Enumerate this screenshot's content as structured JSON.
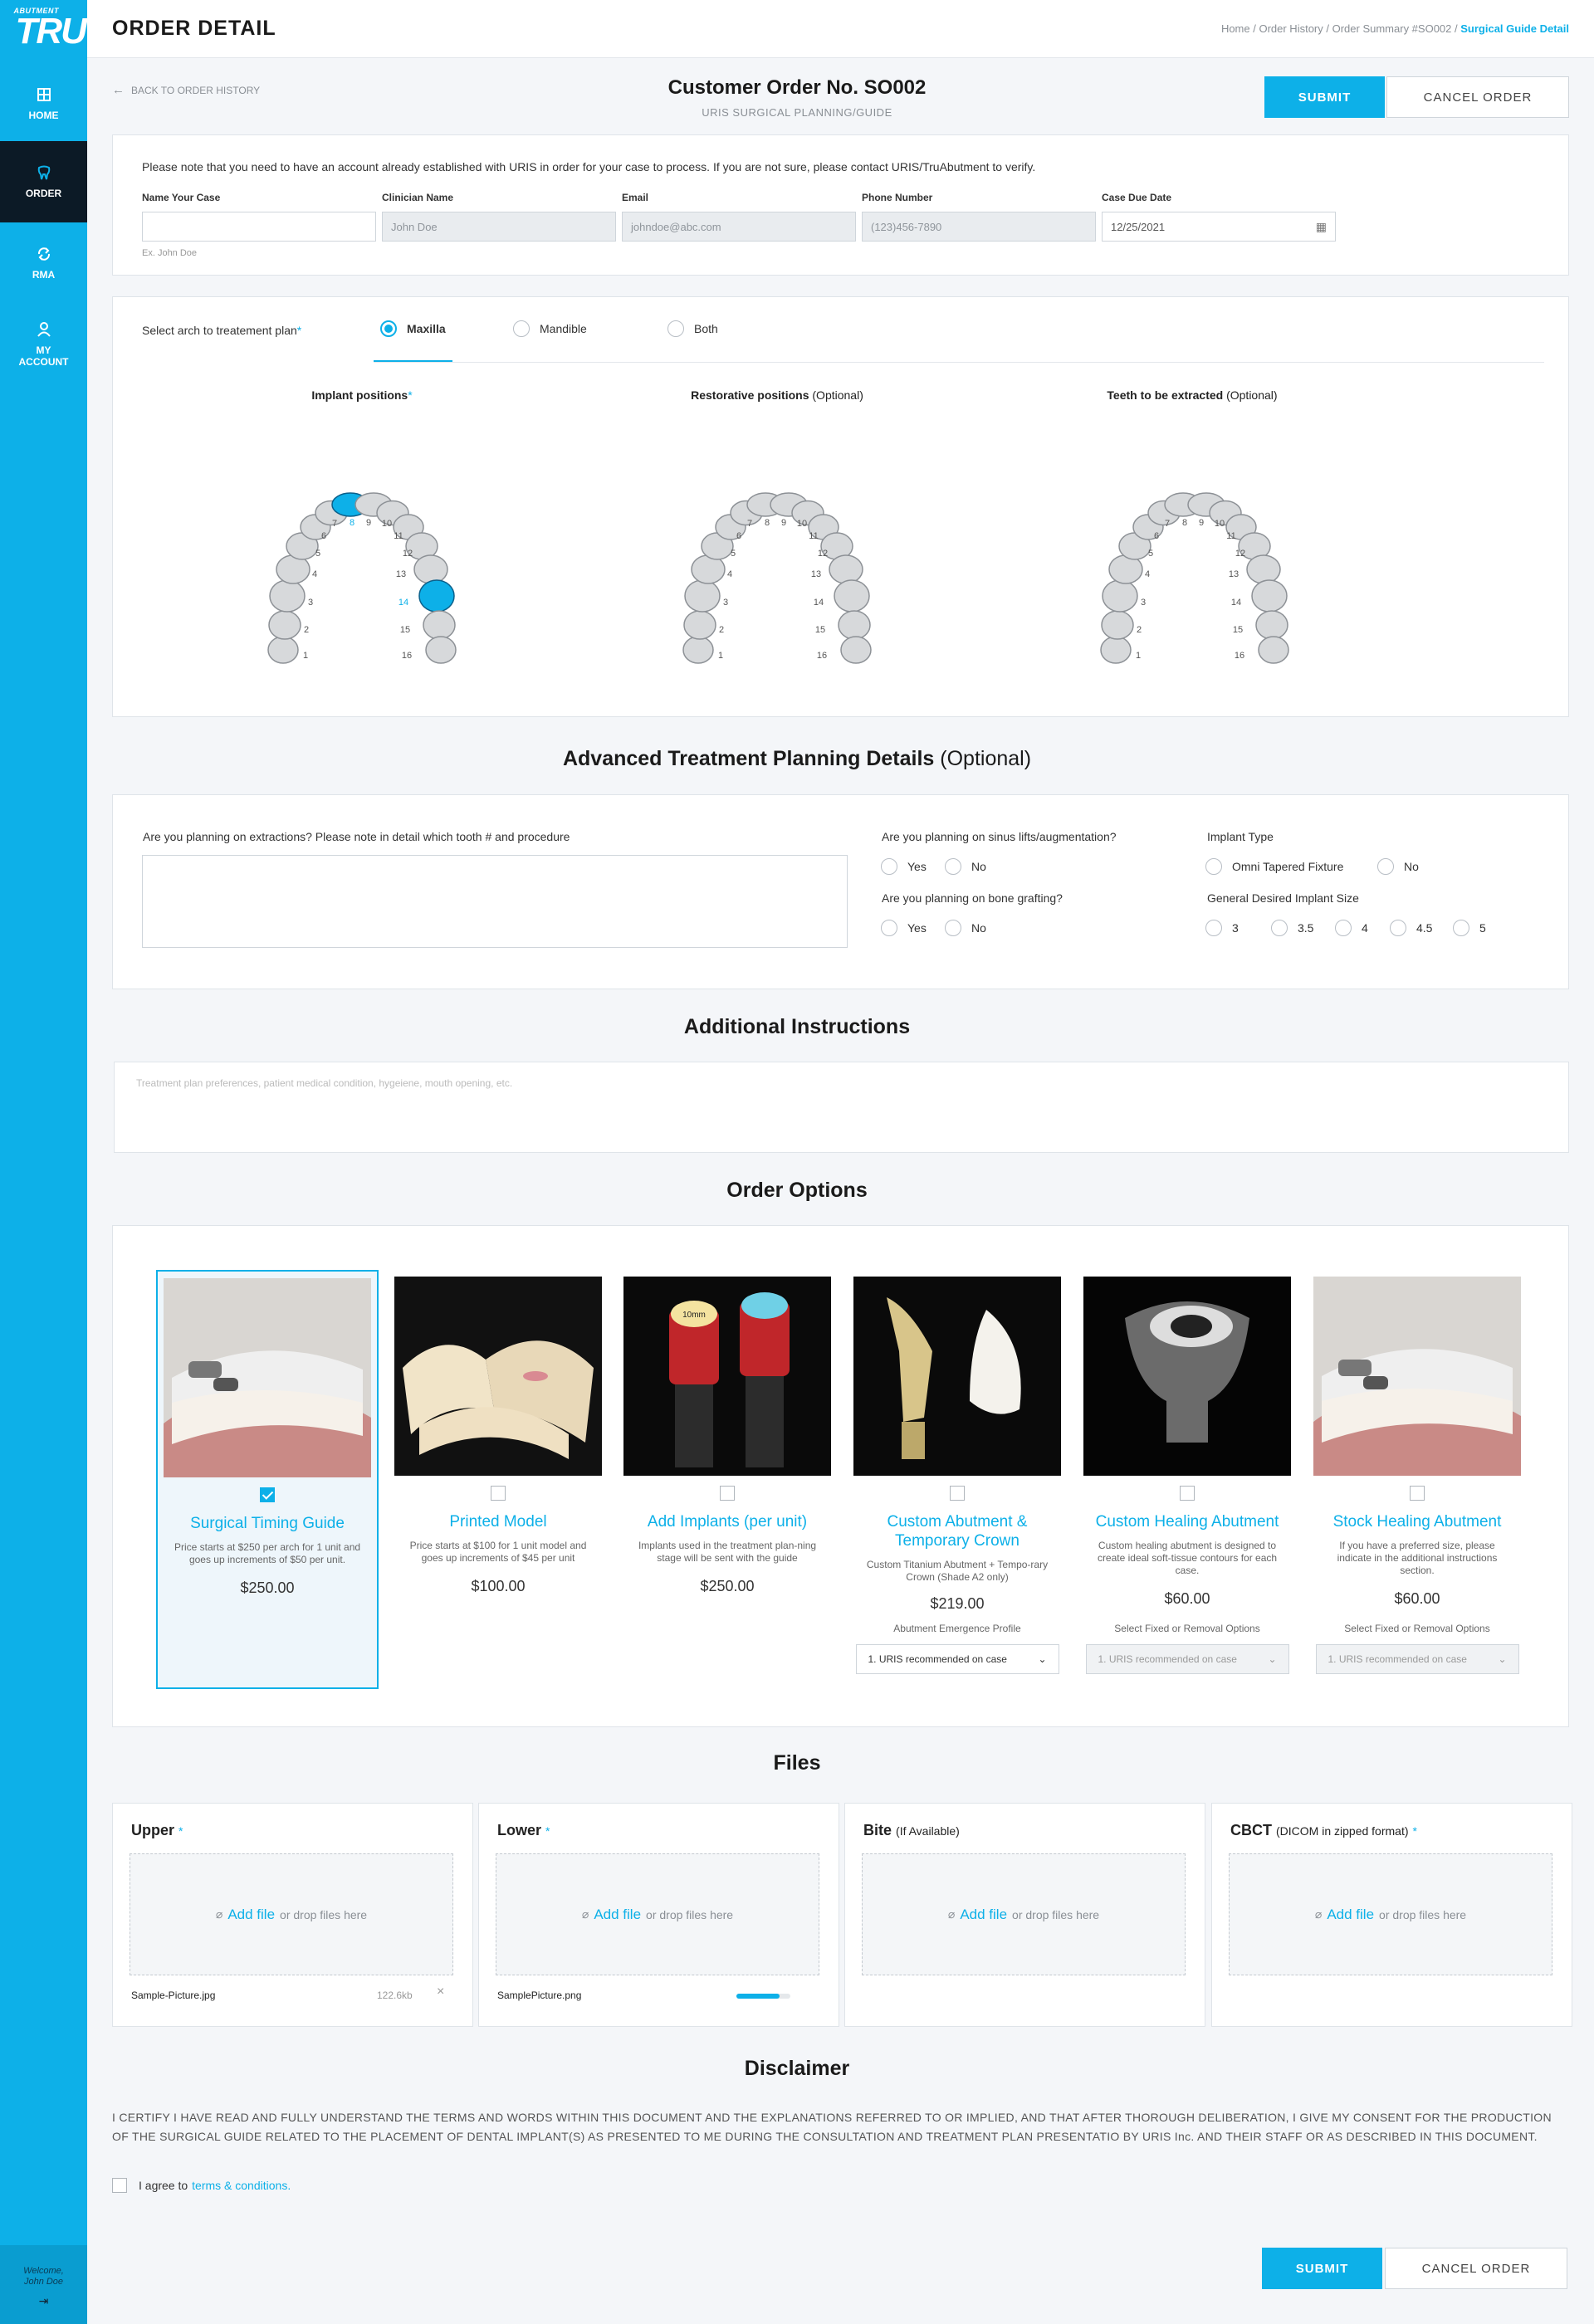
{
  "sidebar": {
    "logo_top": "ABUTMENT",
    "logo_main": "TRU",
    "items": [
      {
        "label": "HOME"
      },
      {
        "label": "ORDER"
      },
      {
        "label": "RMA"
      },
      {
        "label": "MY ACCOUNT"
      }
    ],
    "welcome_line1": "Welcome,",
    "welcome_line2": "John Doe"
  },
  "header": {
    "title": "ORDER DETAIL",
    "breadcrumb": [
      "Home",
      "Order History",
      "Order Summary #SO002",
      "Surgical Guide Detail"
    ]
  },
  "order": {
    "back_label": "BACK TO ORDER HISTORY",
    "title": "Customer Order No. SO002",
    "subtitle": "URIS SURGICAL PLANNING/GUIDE",
    "submit_label": "SUBMIT",
    "cancel_label": "CANCEL ORDER"
  },
  "case_info": {
    "note": "Please note that you need to have an account already established with URIS in order for your case to process. If you are not sure, please contact URIS/TruAbutment to verify.",
    "fields": [
      {
        "label": "Name Your Case",
        "value": "",
        "hint": "Ex. John Doe"
      },
      {
        "label": "Clinician Name",
        "value": "John Doe"
      },
      {
        "label": "Email",
        "value": "johndoe@abc.com"
      },
      {
        "label": "Phone Number",
        "value": "(123)456-7890"
      },
      {
        "label": "Case Due Date",
        "value": "12/25/2021"
      }
    ]
  },
  "arch": {
    "label": "Select arch to treatement plan",
    "options": [
      "Maxilla",
      "Mandible",
      "Both"
    ],
    "selected": "Maxilla",
    "charts": [
      {
        "title_bold": "Implant positions",
        "title_rest": "",
        "required": true
      },
      {
        "title_bold": "Restorative positions",
        "title_rest": " (Optional)",
        "required": false
      },
      {
        "title_bold": "Teeth to be extracted",
        "title_rest": " (Optional)",
        "required": false
      }
    ],
    "tooth_numbers": [
      "1",
      "2",
      "3",
      "4",
      "5",
      "6",
      "7",
      "8",
      "9",
      "10",
      "11",
      "12",
      "13",
      "14",
      "15",
      "16"
    ],
    "selected_implants": [
      "8",
      "14"
    ],
    "highlight_color": "#0db0e8"
  },
  "advanced": {
    "title": "Advanced Treatment Planning Details",
    "title_opt": "(Optional)",
    "extraction_q": "Are you planning on extractions? Please note in detail which tooth # and procedure",
    "sinus_q": "Are you planning on sinus lifts/augmentation?",
    "bone_q": "Are you planning on bone grafting?",
    "yes": "Yes",
    "no": "No",
    "implant_type_q": "Implant Type",
    "implant_type_opts": [
      "Omni Tapered Fixture",
      "No"
    ],
    "size_q": "General Desired Implant Size",
    "sizes": [
      "3",
      "3.5",
      "4",
      "4.5",
      "5"
    ]
  },
  "additional": {
    "title": "Additional Instructions",
    "placeholder": "Treatment plan preferences, patient medical condition, hygeiene, mouth opening, etc."
  },
  "options": {
    "title": "Order Options",
    "items": [
      {
        "name": "Surgical Timing Guide",
        "desc": "Price starts at $250 per arch for 1 unit and goes up increments of $50 per unit.",
        "price": "$250.00",
        "checked": true
      },
      {
        "name": "Printed Model",
        "desc": "Price starts at $100 for 1 unit model and goes up increments of $45 per unit",
        "price": "$100.00",
        "checked": false
      },
      {
        "name": "Add Implants (per unit)",
        "desc": "Implants used in the treatment plan-ning stage will be sent with the guide",
        "price": "$250.00",
        "checked": false
      },
      {
        "name": "Custom Abutment & Temporary Crown",
        "desc": "Custom Titanium Abutment + Tempo-rary Crown (Shade A2 only)",
        "price": "$219.00",
        "checked": false,
        "sub_label": "Abutment Emergence Profile",
        "select_value": "1. URIS recommended on case",
        "select_disabled": false
      },
      {
        "name": "Custom Healing Abutment",
        "desc": "Custom healing abutment is designed to create ideal soft-tissue contours for each case.",
        "price": "$60.00",
        "checked": false,
        "sub_label": "Select Fixed or Removal Options",
        "select_value": "1. URIS recommended on case",
        "select_disabled": true
      },
      {
        "name": "Stock Healing Abutment",
        "desc": "If you have a preferred size, please indicate in the additional instructions section.",
        "price": "$60.00",
        "checked": false,
        "sub_label": "Select Fixed or Removal Options",
        "select_value": "1. URIS recommended on case",
        "select_disabled": true
      }
    ],
    "bottle_label": "10mm"
  },
  "files": {
    "title": "Files",
    "add_label": "Add file",
    "drop_label": "or drop files here",
    "cards": [
      {
        "title": "Upper",
        "paren": "",
        "required": true,
        "file": "Sample-Picture.jpg",
        "size": "122.6kb",
        "progress": null
      },
      {
        "title": "Lower",
        "paren": "",
        "required": true,
        "file": "SamplePicture.png",
        "size": "",
        "progress": 0.8
      },
      {
        "title": "Bite",
        "paren": "(If Available)",
        "required": false,
        "file": "",
        "size": "",
        "progress": null
      },
      {
        "title": "CBCT",
        "paren": "(DICOM in zipped format)",
        "required": true,
        "file": "",
        "size": "",
        "progress": null
      }
    ]
  },
  "disclaimer": {
    "title": "Disclaimer",
    "text": "I CERTIFY I HAVE READ AND FULLY UNDERSTAND THE TERMS AND WORDS WITHIN THIS DOCUMENT AND THE EXPLANATIONS REFERRED TO OR IMPLIED, AND THAT AFTER THOROUGH DELIBERATION, I GIVE MY CONSENT FOR THE PRODUCTION OF THE SURGICAL GUIDE RELATED TO THE PLACEMENT OF DENTAL IMPLANT(S) AS PRESENTED TO ME DURING THE CONSULTATION AND TREATMENT PLAN PRESENTATIO BY URIS Inc. AND THEIR STAFF OR AS DESCRIBED IN THIS DOCUMENT.",
    "agree_label": "I agree to",
    "terms_link": "terms & conditions."
  },
  "colors": {
    "accent": "#0db0e8",
    "sidebar_active": "#0c1a26"
  }
}
